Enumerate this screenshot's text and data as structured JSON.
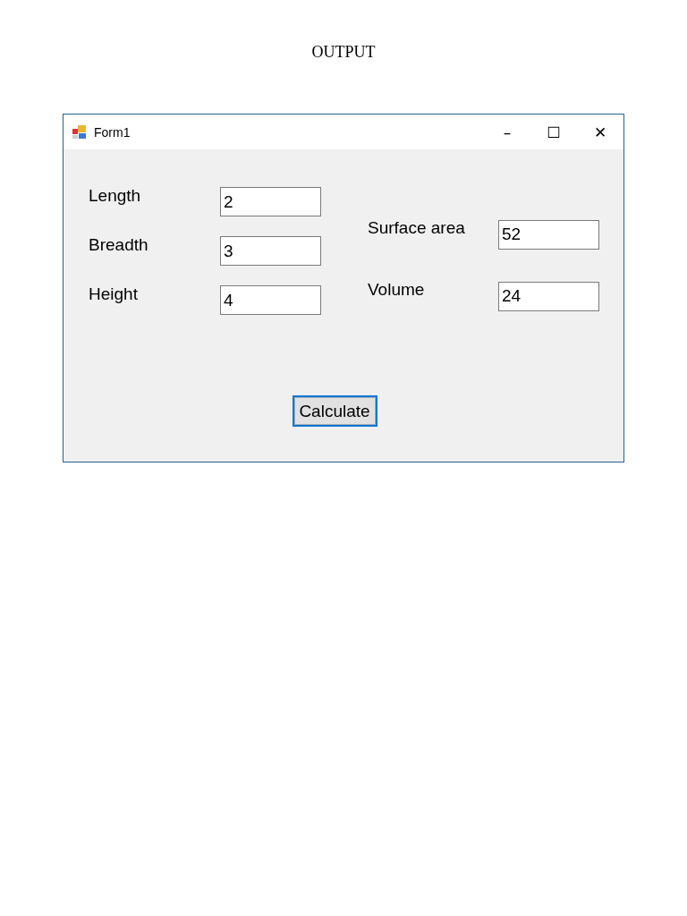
{
  "heading": "OUTPUT",
  "window": {
    "title": "Form1",
    "controls": [
      "–",
      "☐",
      "✕"
    ]
  },
  "inputs": [
    {
      "label": "Length",
      "value": "2"
    },
    {
      "label": "Breadth",
      "value": "3"
    },
    {
      "label": "Height",
      "value": "4"
    }
  ],
  "outputs": [
    {
      "label": "Surface area",
      "value": "52"
    },
    {
      "label": "Volume",
      "value": "24"
    }
  ],
  "button": {
    "label": "Calculate"
  }
}
